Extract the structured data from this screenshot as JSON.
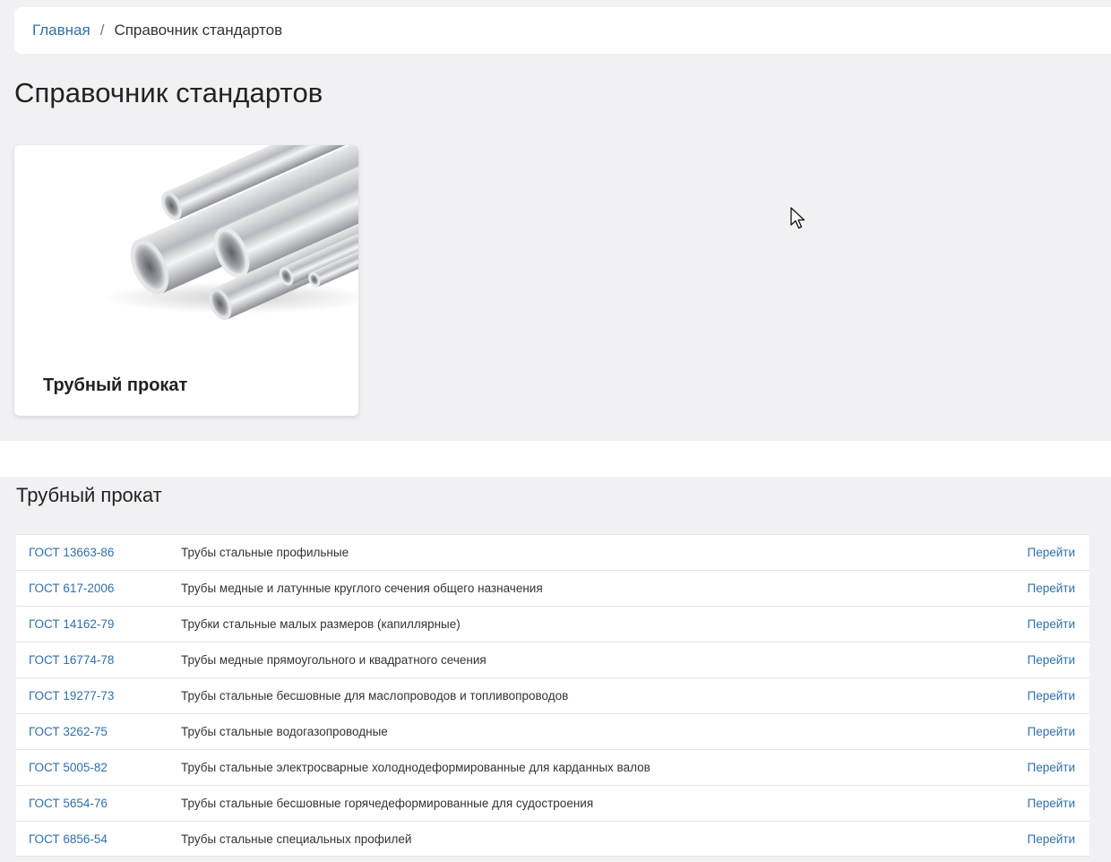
{
  "breadcrumb": {
    "home": "Главная",
    "separator": "/",
    "current": "Справочник стандартов"
  },
  "page": {
    "title": "Справочник стандартов"
  },
  "card": {
    "title": "Трубный прокат",
    "image": "steel-pipes-image"
  },
  "section": {
    "title": "Трубный прокат"
  },
  "standards": [
    {
      "code": "ГОСТ 13663-86",
      "description": "Трубы стальные профильные",
      "action": "Перейти"
    },
    {
      "code": "ГОСТ 617-2006",
      "description": "Трубы медные и латунные круглого сечения общего назначения",
      "action": "Перейти"
    },
    {
      "code": "ГОСТ 14162-79",
      "description": "Трубки стальные малых размеров (капиллярные)",
      "action": "Перейти"
    },
    {
      "code": "ГОСТ 16774-78",
      "description": "Трубы медные прямоугольного и квадратного сечения",
      "action": "Перейти"
    },
    {
      "code": "ГОСТ 19277-73",
      "description": "Трубы стальные бесшовные для маслопроводов и топливопроводов",
      "action": "Перейти"
    },
    {
      "code": "ГОСТ 3262-75",
      "description": "Трубы стальные водогазопроводные",
      "action": "Перейти"
    },
    {
      "code": "ГОСТ 5005-82",
      "description": "Трубы стальные электросварные холоднодеформированные для карданных валов",
      "action": "Перейти"
    },
    {
      "code": "ГОСТ 5654-76",
      "description": "Трубы стальные бесшовные горячедеформированные для судостроения",
      "action": "Перейти"
    },
    {
      "code": "ГОСТ 6856-54",
      "description": "Трубы стальные специальных профилей",
      "action": "Перейти"
    }
  ],
  "colors": {
    "link": "#2f6fb0",
    "background": "#f1f1f3",
    "surface": "#ffffff",
    "text": "#222222"
  }
}
